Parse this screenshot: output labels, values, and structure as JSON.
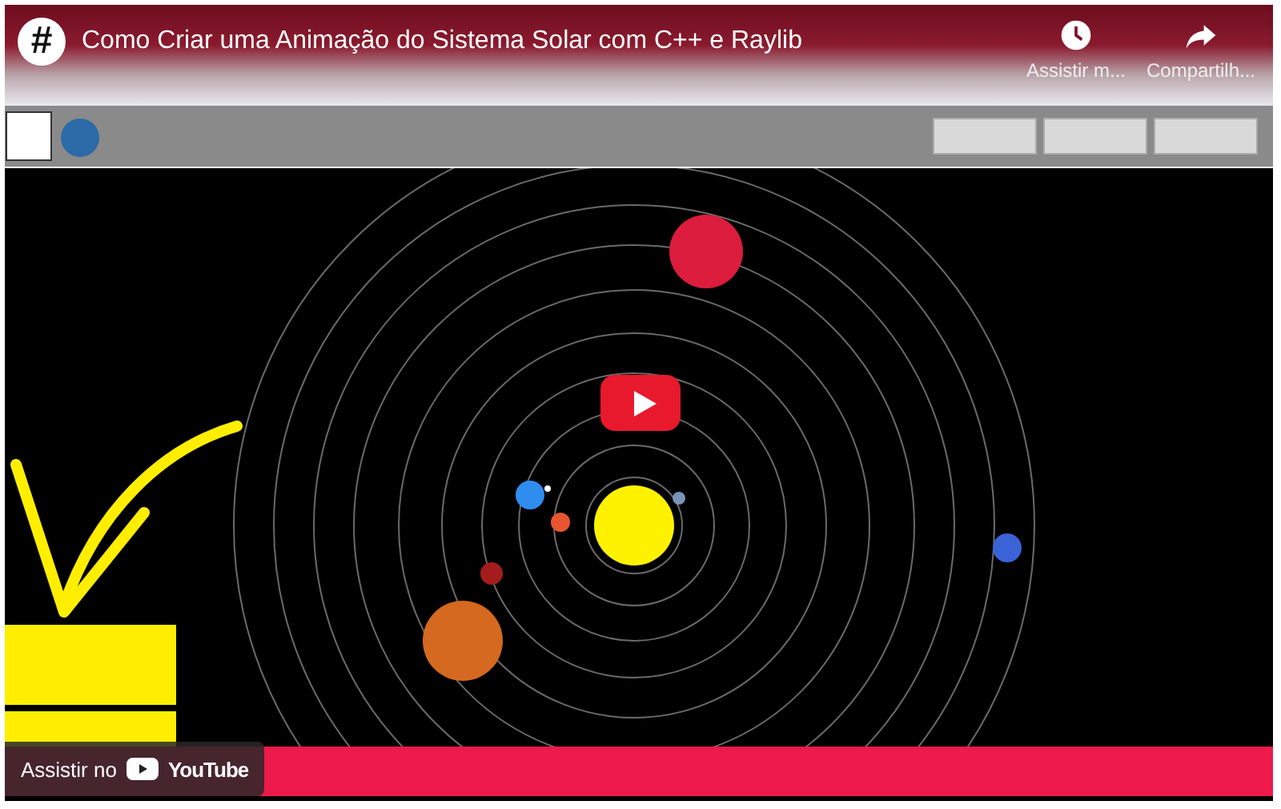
{
  "video": {
    "channel_avatar": "#",
    "title": "Como Criar uma Animação do Sistema Solar com C++ e Raylib"
  },
  "actions": [
    {
      "kind": "watch_later",
      "label": "Assistir m..."
    },
    {
      "kind": "share",
      "label": "Compartilh..."
    }
  ],
  "watch_on": {
    "label": "Assistir no",
    "brand": "YouTube"
  }
}
